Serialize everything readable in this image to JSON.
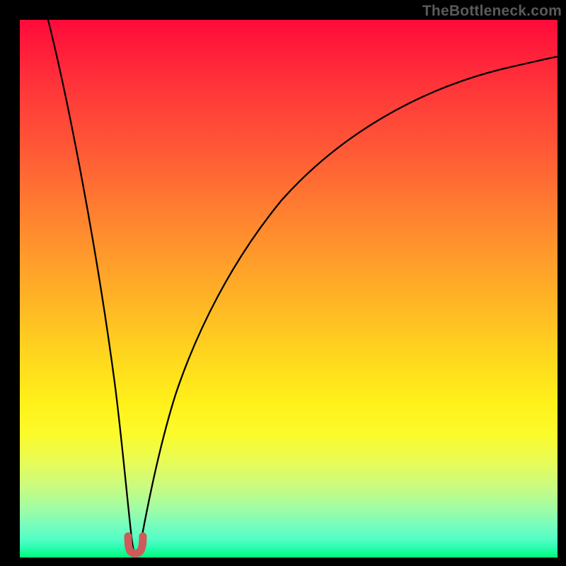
{
  "brand": {
    "link_text": "TheBottleneck.com"
  },
  "chart_data": {
    "type": "line",
    "title": "",
    "xlabel": "",
    "ylabel": "",
    "xlim": [
      0,
      100
    ],
    "ylim": [
      0,
      100
    ],
    "grid": false,
    "legend": false,
    "series": [
      {
        "name": "bottleneck-curve",
        "x": [
          0,
          4,
          8,
          12,
          15,
          17,
          18.5,
          19.5,
          20.3,
          20.9,
          21.3,
          21.8,
          22.3,
          23,
          24,
          26,
          29,
          33,
          38,
          44,
          51,
          59,
          68,
          78,
          89,
          100
        ],
        "y": [
          100,
          80,
          60,
          41,
          27,
          17,
          10,
          5.2,
          2.4,
          1.1,
          0.9,
          1.1,
          2.2,
          4.4,
          8.5,
          16,
          25,
          34,
          43,
          51,
          58.5,
          65,
          70.5,
          75,
          78.8,
          82
        ]
      }
    ],
    "marker": {
      "name": "minimum",
      "x": 21.3,
      "y": 0.9,
      "color": "#cf5a5c"
    },
    "gradient_stops": [
      {
        "pct": 0,
        "color": "#ff0a3a"
      },
      {
        "pct": 50,
        "color": "#ffba24"
      },
      {
        "pct": 78,
        "color": "#fcfb2a"
      },
      {
        "pct": 100,
        "color": "#00f778"
      }
    ]
  }
}
